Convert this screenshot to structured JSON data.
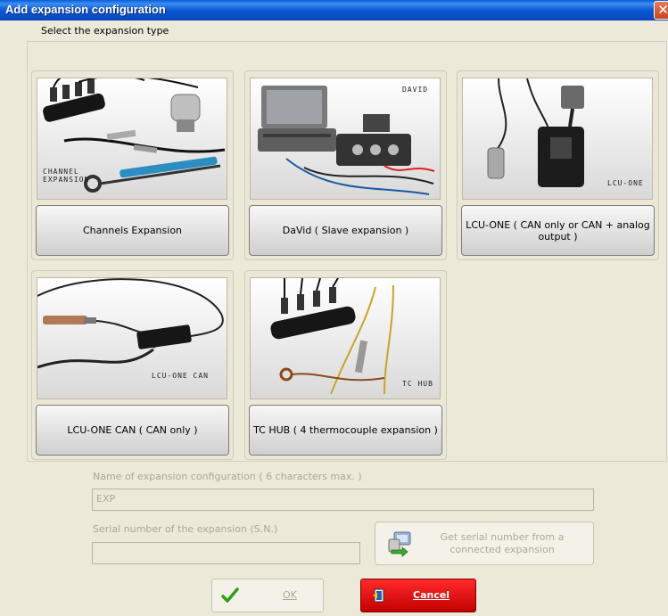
{
  "window": {
    "title": "Add expansion configuration",
    "close_glyph": "✕"
  },
  "prompt": "Select the expansion type",
  "cards": [
    {
      "label": "Channels Expansion",
      "image_caption": "CHANNEL\nEXPANSION"
    },
    {
      "label": "DaVid  ( Slave expansion )",
      "image_caption": "DAVID"
    },
    {
      "label": "LCU-ONE  ( CAN only or CAN + analog output )",
      "image_caption": "LCU-ONE"
    },
    {
      "label": "LCU-ONE CAN  ( CAN only )",
      "image_caption": "LCU-ONE CAN"
    },
    {
      "label": "TC HUB  ( 4 thermocouple expansion )",
      "image_caption": "TC HUB"
    }
  ],
  "name_field": {
    "label": "Name of expansion configuration ( 6 characters max. )",
    "value": "EXP"
  },
  "serial_field": {
    "label": "Serial number of the expansion (S.N.)",
    "value": ""
  },
  "serial_button": {
    "label": "Get serial number from a connected expansion",
    "icon": "computer-transfer-icon"
  },
  "ok_button": {
    "label": "OK",
    "icon": "checkmark-icon",
    "icon_color": "#2e9e17"
  },
  "cancel_button": {
    "label": "Cancel",
    "icon": "door-exit-icon",
    "color": "#e01010"
  },
  "colors": {
    "titlebar": "#0b58d2",
    "dialog_bg": "#ece9d8",
    "disabled_text": "#aca899"
  }
}
